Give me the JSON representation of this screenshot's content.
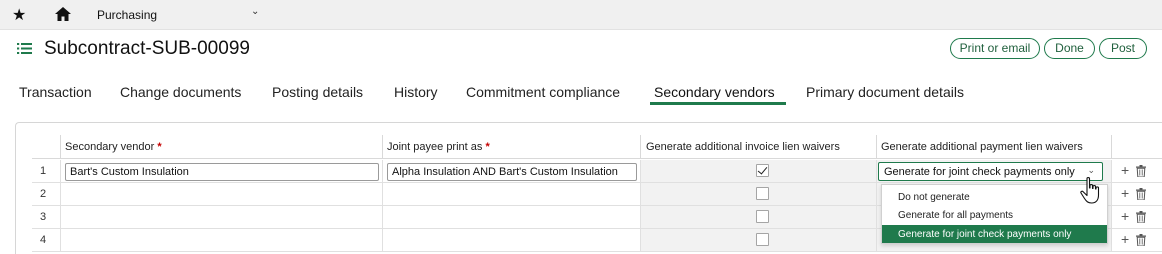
{
  "topbar": {
    "module_label": "Purchasing",
    "icons": [
      "star-icon",
      "home-icon",
      "chevron-down-icon"
    ]
  },
  "header": {
    "title": "Subcontract-SUB-00099",
    "buttons": {
      "print_email": "Print or email",
      "done": "Done",
      "post": "Post"
    }
  },
  "tabs": [
    "Transaction",
    "Change documents",
    "Posting details",
    "History",
    "Commitment compliance",
    "Secondary vendors",
    "Primary document details"
  ],
  "active_tab": "Secondary vendors",
  "grid": {
    "columns": {
      "secondary_vendor": "Secondary vendor",
      "joint_payee": "Joint payee print as",
      "invoice_waivers": "Generate additional invoice lien waivers",
      "payment_waivers": "Generate additional payment lien waivers"
    },
    "required_marker": "*",
    "rows": [
      {
        "num": "1",
        "vendor": "Bart's Custom Insulation",
        "joint_payee": "Alpha Insulation AND Bart's Custom Insulation",
        "invoice_checked": true,
        "payment_value": "Generate for joint check payments only"
      },
      {
        "num": "2",
        "vendor": "",
        "joint_payee": "",
        "invoice_checked": false,
        "payment_value": ""
      },
      {
        "num": "3",
        "vendor": "",
        "joint_payee": "",
        "invoice_checked": false,
        "payment_value": ""
      },
      {
        "num": "4",
        "vendor": "",
        "joint_payee": "",
        "invoice_checked": false,
        "payment_value": ""
      }
    ],
    "row_actions": {
      "add": "+",
      "delete": "trash-icon"
    }
  },
  "dropdown": {
    "options": [
      "Do not generate",
      "Generate for all payments",
      "Generate for joint check payments only"
    ],
    "selected": "Generate for joint check payments only"
  },
  "colors": {
    "accent": "#1f7a4c",
    "required": "#c40000"
  }
}
